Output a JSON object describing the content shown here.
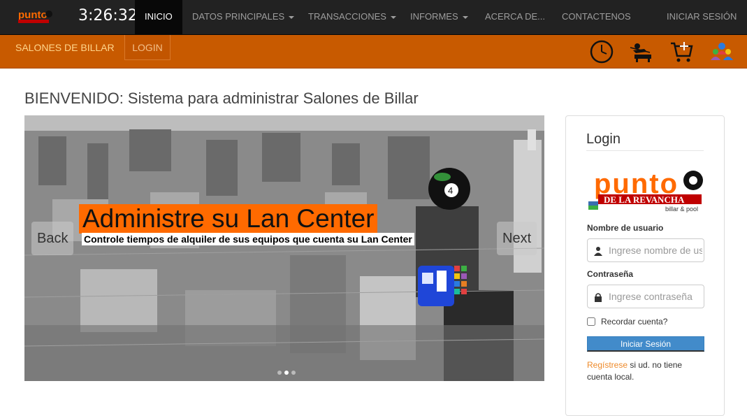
{
  "clock": "3:26:32",
  "logo": {
    "text": "punto"
  },
  "nav": {
    "items": [
      {
        "label": "INICIO",
        "active": true
      },
      {
        "label": "DATOS PRINCIPALES",
        "dropdown": true
      },
      {
        "label": "TRANSACCIONES",
        "dropdown": true
      },
      {
        "label": "INFORMES",
        "dropdown": true
      },
      {
        "label": "ACERCA DE..."
      },
      {
        "label": "CONTACTENOS"
      }
    ],
    "signin": "INICIAR SESIÓN"
  },
  "subbar": {
    "brand": "SALONES DE BILLAR",
    "login": "LOGIN",
    "icons": [
      "clock-icon",
      "billiards-player-icon",
      "shopping-cart-icon",
      "users-group-icon"
    ]
  },
  "welcome": "BIENVENIDO: Sistema para administrar Salones de Billar",
  "carousel": {
    "back": "Back",
    "next": "Next",
    "headline": "Administre su Lan Center",
    "subline": "Controle tiempos de alquiler de sus equipos que cuenta su Lan Center",
    "ball_number": "4",
    "slides": 3,
    "active_slide": 1
  },
  "login_panel": {
    "title": "Login",
    "logo_text": "punto",
    "logo_sub": "DE LA REVANCHA",
    "logo_tag": "billar & pool",
    "username_label": "Nombre de usuario",
    "username_placeholder": "Ingrese nombre de usuario",
    "password_label": "Contraseña",
    "password_placeholder": "Ingrese contraseña",
    "remember": "Recordar cuenta?",
    "submit": "Iniciar Sesión",
    "register_link": "Regístrese",
    "register_text": " si ud. no tiene cuenta local."
  },
  "colors": {
    "navbar": "#222222",
    "subbar": "#c85a00",
    "accent": "#ff6a00",
    "button": "#428bca"
  }
}
